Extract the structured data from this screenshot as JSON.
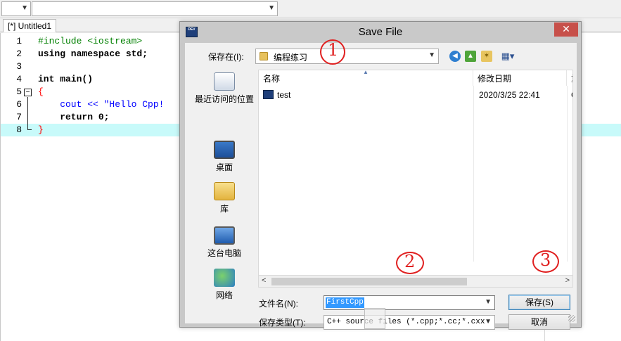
{
  "ide": {
    "tab_label": "[*] Untitled1",
    "code_lines": [
      {
        "num": "1",
        "text": "#include <iostream>"
      },
      {
        "num": "2",
        "text": "using namespace std;"
      },
      {
        "num": "3",
        "text": ""
      },
      {
        "num": "4",
        "text": "int main()"
      },
      {
        "num": "5",
        "text": "{"
      },
      {
        "num": "6",
        "text": "    cout << \"Hello Cpp!"
      },
      {
        "num": "7",
        "text": "    return 0;"
      },
      {
        "num": "8",
        "text": "}"
      }
    ]
  },
  "dialog": {
    "title": "Save File",
    "close_glyph": "✕",
    "title_icon_text": "DEV",
    "save_in_label": "保存在(I):",
    "save_in_value": "编程练习",
    "places": [
      {
        "label": "最近访问的位置",
        "icon": "recent-places-icon"
      },
      {
        "label": "桌面",
        "icon": "desktop-icon"
      },
      {
        "label": "库",
        "icon": "library-icon"
      },
      {
        "label": "这台电脑",
        "icon": "computer-icon"
      },
      {
        "label": "网络",
        "icon": "network-icon"
      }
    ],
    "columns": {
      "name": "名称",
      "date": "修改日期",
      "extra": "重"
    },
    "files": [
      {
        "name": "test",
        "date": "2020/3/25 22:41",
        "extra": "C"
      }
    ],
    "filename_label": "文件名(N):",
    "filename_value": "FirstCpp",
    "filetype_label": "保存类型(T):",
    "filetype_value": "C++ source files (*.cpp;*.cc;*.cxx;*.",
    "save_button": "保存(S)",
    "cancel_button": "取消"
  },
  "annotations": {
    "a1": "1",
    "a2": "2",
    "a3": "3"
  },
  "colors": {
    "active_line": "#c8fafa",
    "close_button": "#c7504a",
    "selection": "#3399ff",
    "annotation": "#e02020"
  }
}
